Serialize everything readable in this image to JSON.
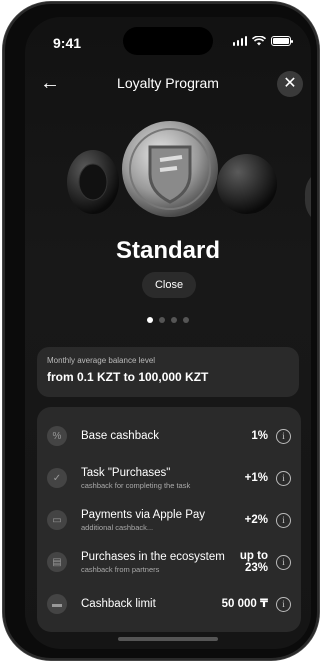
{
  "status": {
    "time": "9:41"
  },
  "header": {
    "title": "Loyalty Program",
    "back_icon": "arrow-left-icon",
    "close_icon": "close-icon"
  },
  "tier": {
    "name": "Standard",
    "close_label": "Close",
    "page_dots": 4,
    "active_dot": 0
  },
  "balance": {
    "label": "Monthly average balance level",
    "value": "from 0.1 KZT to 100,000 KZT"
  },
  "cashback": [
    {
      "name": "Base cashback",
      "sub": "",
      "value": "1%",
      "icon": "percent-icon"
    },
    {
      "name": "Task \"Purchases\"",
      "sub": "cashback for completing the task",
      "value": "+1%",
      "icon": "check-icon"
    },
    {
      "name": "Payments via Apple Pay",
      "sub": "additional cashback...",
      "value": "+2%",
      "icon": "wallet-icon"
    },
    {
      "name": "Purchases in the ecosystem",
      "sub": "cashback from partners",
      "value": "up to 23%",
      "icon": "store-icon"
    },
    {
      "name": "Cashback limit",
      "sub": "",
      "value": "50 000 ₸",
      "icon": "card-icon"
    }
  ],
  "colors": {
    "background": "#151515",
    "card": "#2a2a2a",
    "text": "#ffffff",
    "muted": "#aaaaaa"
  }
}
